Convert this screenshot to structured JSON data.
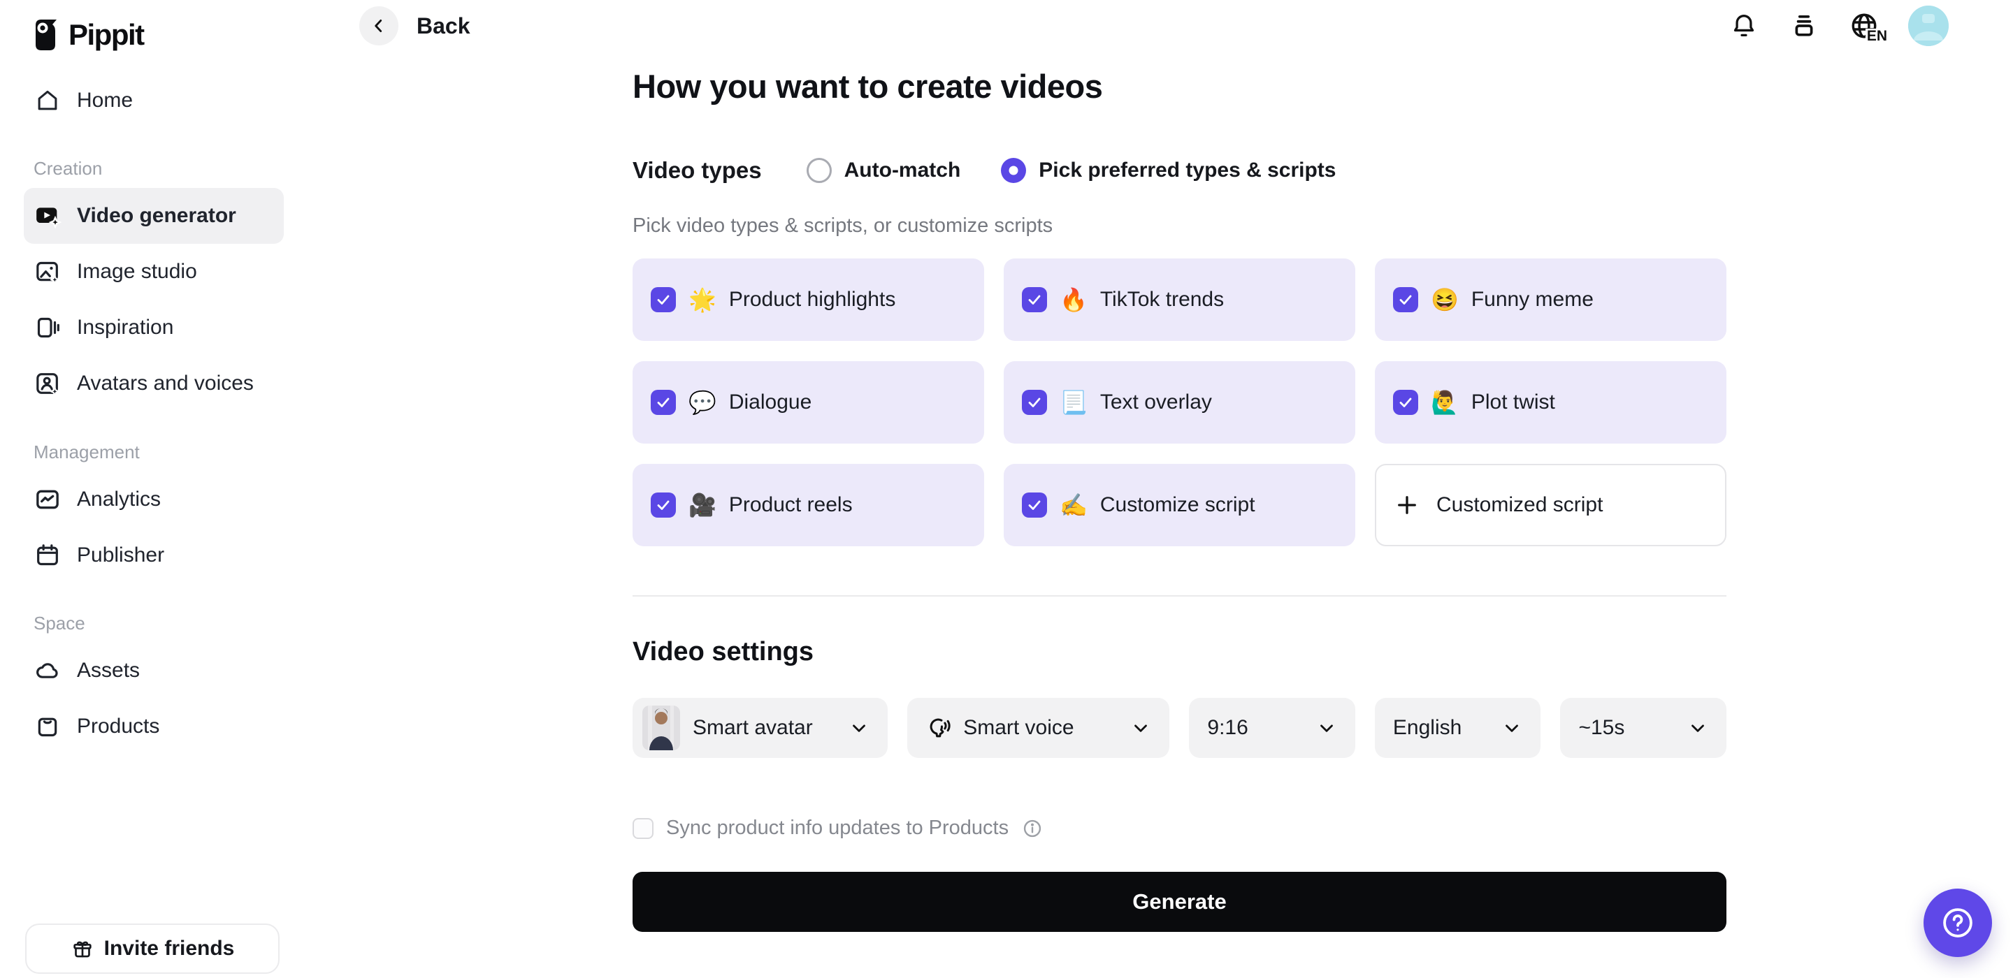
{
  "app": {
    "name": "Pippit"
  },
  "topbar": {
    "back_label": "Back",
    "language_code": "EN"
  },
  "sidebar": {
    "home_label": "Home",
    "sections": [
      {
        "label": "Creation",
        "items": [
          {
            "label": "Video generator",
            "active": true
          },
          {
            "label": "Image studio",
            "active": false
          },
          {
            "label": "Inspiration",
            "active": false
          },
          {
            "label": "Avatars and voices",
            "active": false
          }
        ]
      },
      {
        "label": "Management",
        "items": [
          {
            "label": "Analytics",
            "active": false
          },
          {
            "label": "Publisher",
            "active": false
          }
        ]
      },
      {
        "label": "Space",
        "items": [
          {
            "label": "Assets",
            "active": false
          },
          {
            "label": "Products",
            "active": false
          }
        ]
      }
    ],
    "invite_label": "Invite friends"
  },
  "main": {
    "title": "How you want to create videos",
    "video_types": {
      "label": "Video types",
      "options": [
        {
          "label": "Auto-match",
          "selected": false
        },
        {
          "label": "Pick preferred types & scripts",
          "selected": true
        }
      ],
      "hint": "Pick video types & scripts, or customize scripts",
      "cards": [
        {
          "emoji": "🌟",
          "label": "Product highlights",
          "checked": true
        },
        {
          "emoji": "🔥",
          "label": "TikTok trends",
          "checked": true
        },
        {
          "emoji": "😆",
          "label": "Funny meme",
          "checked": true
        },
        {
          "emoji": "💬",
          "label": "Dialogue",
          "checked": true
        },
        {
          "emoji": "📃",
          "label": "Text overlay",
          "checked": true
        },
        {
          "emoji": "🙋‍♂️",
          "label": "Plot twist",
          "checked": true
        },
        {
          "emoji": "🎥",
          "label": "Product reels",
          "checked": true
        },
        {
          "emoji": "✍️",
          "label": "Customize script",
          "checked": true
        }
      ],
      "add_card": {
        "label": "Customized script"
      }
    },
    "settings": {
      "title": "Video settings",
      "dropdowns": [
        {
          "label": "Smart avatar"
        },
        {
          "label": "Smart voice"
        },
        {
          "label": "9:16"
        },
        {
          "label": "English"
        },
        {
          "label": "~15s"
        }
      ],
      "sync": {
        "label": "Sync product info updates to Products",
        "checked": false
      }
    },
    "generate_label": "Generate"
  },
  "colors": {
    "accent": "#5A47E5",
    "card_bg": "#ECE9FA",
    "avatar_bg": "#A9E1EC"
  }
}
